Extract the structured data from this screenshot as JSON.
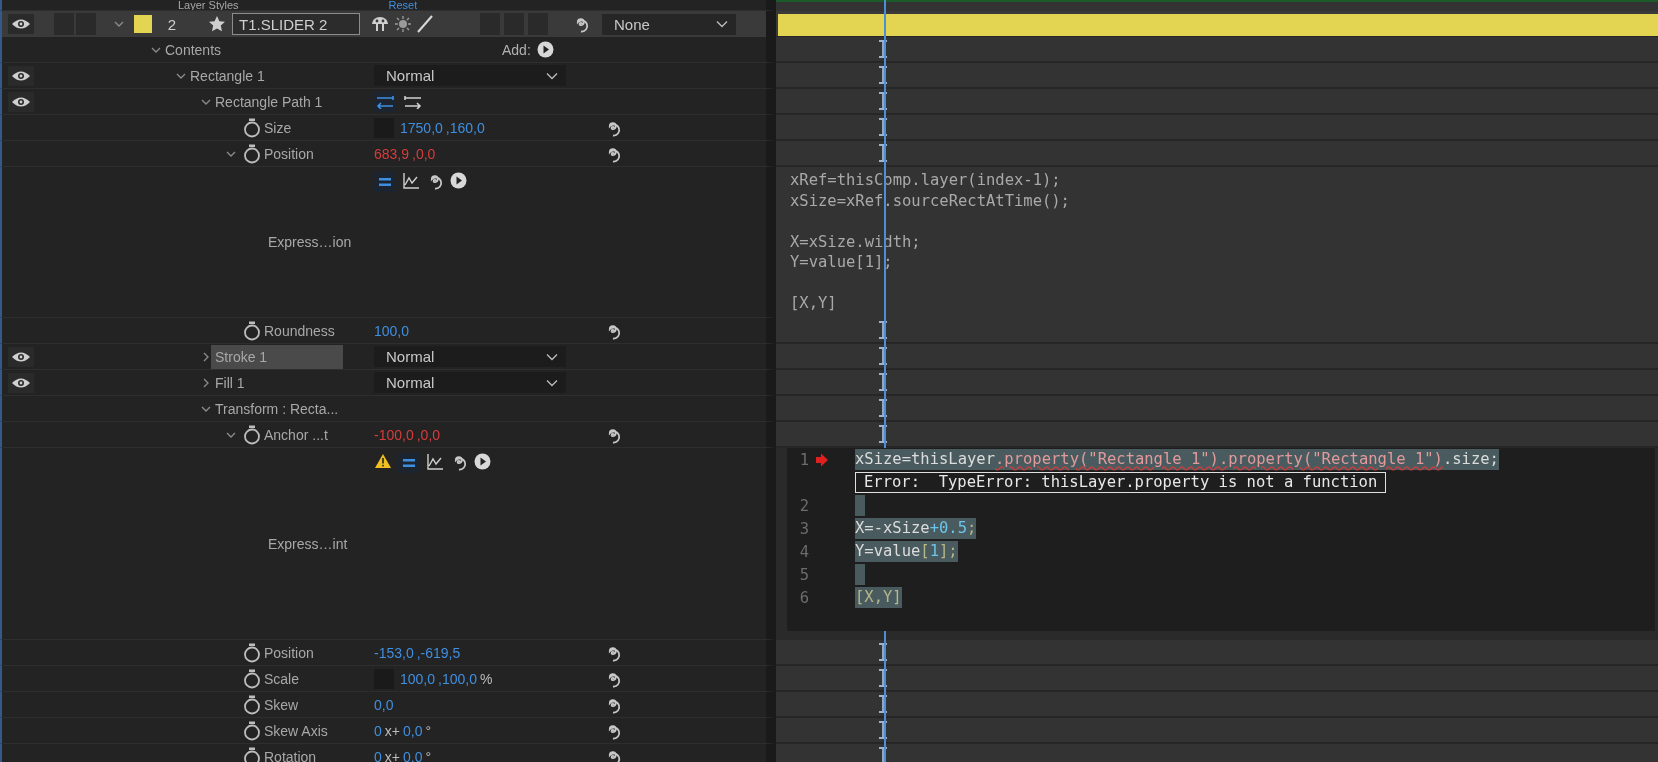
{
  "partial_row": {
    "label": "Layer Styles",
    "action": "Reset"
  },
  "layer": {
    "visible": true,
    "expanded": true,
    "selected": true,
    "color": "#e3d552",
    "number": "2",
    "name": "T1.SLIDER 2",
    "parent": "None"
  },
  "properties": [
    {
      "kind": "group",
      "label": "Contents",
      "expanded": true,
      "selected": false,
      "add_label": "Add:",
      "children": [
        {
          "kind": "group",
          "label": "Rectangle 1",
          "visible": true,
          "expanded": true,
          "selected": false,
          "blend": "Normal",
          "children": [
            {
              "kind": "group",
              "label": "Rectangle Path 1",
              "visible": true,
              "expanded": true,
              "selected": false,
              "path_direction": true,
              "children": [
                {
                  "kind": "property",
                  "label": "Size",
                  "selected": false,
                  "lock_box": true,
                  "value_parts": [
                    {
                      "kind": "number",
                      "text": "1750,0"
                    },
                    {
                      "kind": "number",
                      "text": ",160,0"
                    }
                  ]
                },
                {
                  "kind": "property",
                  "label": "Position",
                  "selected": false,
                  "expanded": true,
                  "value_parts": [
                    {
                      "kind": "number",
                      "text": "683,9"
                    },
                    {
                      "kind": "number",
                      "text": ",0,0"
                    }
                  ],
                  "expression": {
                    "kind": "plain",
                    "label": "Express…ion",
                    "warning": false,
                    "code": "xRef=thisComp.layer(index-1);\nxSize=xRef.sourceRectAtTime();\n\nX=xSize.width;\nY=value[1];\n\n[X,Y]"
                  }
                },
                {
                  "kind": "property",
                  "label": "Roundness",
                  "selected": false,
                  "value_parts": [
                    {
                      "kind": "number",
                      "text": "100,0"
                    }
                  ]
                }
              ]
            },
            {
              "kind": "group",
              "label": "Stroke 1",
              "visible": true,
              "expanded": false,
              "selected": true,
              "blend": "Normal"
            },
            {
              "kind": "group",
              "label": "Fill 1",
              "visible": true,
              "expanded": false,
              "selected": false,
              "blend": "Normal"
            },
            {
              "kind": "group",
              "label": "Transform : Recta...",
              "expanded": true,
              "selected": false,
              "children": [
                {
                  "kind": "property",
                  "label": "Anchor ...t",
                  "selected": false,
                  "expanded": true,
                  "value_parts": [
                    {
                      "kind": "number",
                      "text": "-100,0"
                    },
                    {
                      "kind": "number",
                      "text": ",0,0"
                    }
                  ],
                  "expression": {
                    "kind": "editor",
                    "label": "Express…int",
                    "warning": true,
                    "lines": [
                      {
                        "number": "1",
                        "error": true,
                        "selected": true,
                        "error_message": "Error:  TypeError: thisLayer.property is not a function",
                        "segments": [
                          {
                            "kind": "plain",
                            "text": "xSize=thisLayer"
                          },
                          {
                            "kind": "error",
                            "text": ".property(\"Rectangle 1\").property(\"Rectangle 1\")"
                          },
                          {
                            "kind": "plain",
                            "text": ".size;"
                          }
                        ]
                      },
                      {
                        "number": "2",
                        "error": false,
                        "selected": true
                      },
                      {
                        "number": "3",
                        "error": false,
                        "selected": true,
                        "segments": [
                          {
                            "kind": "plain",
                            "text": "X=-xSize"
                          },
                          {
                            "kind": "number",
                            "text": "+0.5"
                          },
                          {
                            "kind": "punct",
                            "text": ";"
                          }
                        ]
                      },
                      {
                        "number": "4",
                        "error": false,
                        "selected": true,
                        "segments": [
                          {
                            "kind": "plain",
                            "text": "Y=value"
                          },
                          {
                            "kind": "punct",
                            "text": "["
                          },
                          {
                            "kind": "number",
                            "text": "1"
                          },
                          {
                            "kind": "punct",
                            "text": "];"
                          }
                        ]
                      },
                      {
                        "number": "5",
                        "error": false,
                        "selected": true
                      },
                      {
                        "number": "6",
                        "error": false,
                        "selected": true,
                        "segments": [
                          {
                            "kind": "punct",
                            "text": "[X,Y]"
                          }
                        ]
                      }
                    ]
                  }
                },
                {
                  "kind": "property",
                  "label": "Position",
                  "selected": false,
                  "value_parts": [
                    {
                      "kind": "number",
                      "text": "-153,0"
                    },
                    {
                      "kind": "number",
                      "text": ",-619,5"
                    }
                  ]
                },
                {
                  "kind": "property",
                  "label": "Scale",
                  "selected": false,
                  "lock_box": true,
                  "value_parts": [
                    {
                      "kind": "number",
                      "text": "100,0"
                    },
                    {
                      "kind": "number",
                      "text": ",100,0"
                    },
                    {
                      "kind": "unit",
                      "text": "%"
                    }
                  ]
                },
                {
                  "kind": "property",
                  "label": "Skew",
                  "selected": false,
                  "value_parts": [
                    {
                      "kind": "number",
                      "text": "0,0"
                    }
                  ]
                },
                {
                  "kind": "property",
                  "label": "Skew Axis",
                  "selected": false,
                  "value_parts": [
                    {
                      "kind": "number",
                      "text": "0"
                    },
                    {
                      "kind": "unit",
                      "text": "x+"
                    },
                    {
                      "kind": "number",
                      "text": "0,0"
                    },
                    {
                      "kind": "unit",
                      "text": "°"
                    }
                  ]
                },
                {
                  "kind": "property",
                  "label": "Rotation",
                  "selected": false,
                  "value_parts": [
                    {
                      "kind": "number",
                      "text": "0"
                    },
                    {
                      "kind": "unit",
                      "text": "x+"
                    },
                    {
                      "kind": "number",
                      "text": "0,0"
                    },
                    {
                      "kind": "unit",
                      "text": "°"
                    }
                  ]
                }
              ]
            }
          ]
        }
      ]
    }
  ]
}
